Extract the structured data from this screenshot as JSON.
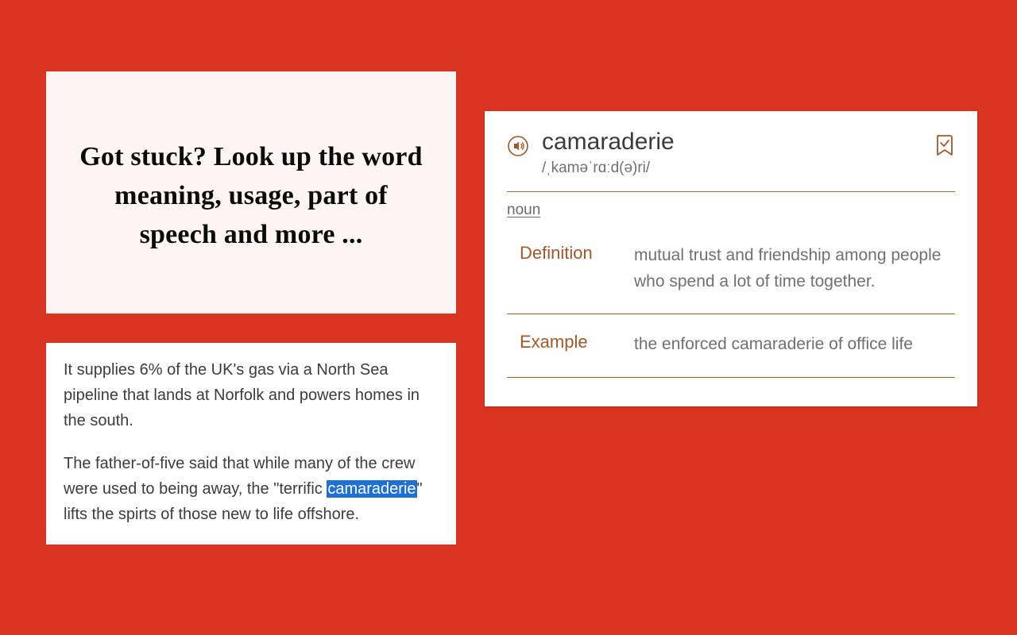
{
  "headline": "Got stuck? Look up the word meaning, usage, part of speech and more ...",
  "article": {
    "para1": "It supplies 6% of the UK's gas via a North Sea pipeline that lands at Norfolk and powers homes in the south.",
    "para2_pre": "The father-of-five said that while many of the crew were used to being away, the \"terrific ",
    "para2_highlight": "camaraderie",
    "para2_post": "\" lifts the spirts of those new to life offshore."
  },
  "dictionary": {
    "word": "camaraderie",
    "phonetic": "/ˌkaməˈrɑːd(ə)ri/",
    "pos": "noun",
    "definition_label": "Definition",
    "definition": "mutual trust and friendship among people who spend a lot of time together.",
    "example_label": "Example",
    "example": "the enforced camaraderie of office life"
  }
}
